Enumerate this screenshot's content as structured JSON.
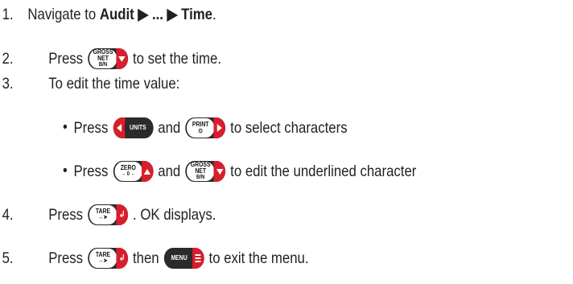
{
  "steps": [
    {
      "num": "1.",
      "pre": "Navigate to ",
      "bold": "Audit ▶ ... ▶  Time",
      "post": "."
    },
    {
      "num": "2.",
      "pre": "Press",
      "post": "to set the time."
    },
    {
      "num": "3.",
      "text": "To edit the time value:"
    },
    {
      "num": "4.",
      "pre": "Press",
      "post": ". OK displays."
    },
    {
      "num": "5.",
      "pre": "Press",
      "mid": "then",
      "post": "to exit the menu."
    }
  ],
  "substeps": [
    {
      "bullet": "•",
      "pre": "Press",
      "mid": "and",
      "post": "to select characters"
    },
    {
      "bullet": "•",
      "pre": "Press",
      "mid": "and",
      "post": "to edit the underlined character"
    }
  ],
  "keys": {
    "gross_net": {
      "l1": "GROSS",
      "l2": "NET",
      "l3": "B/N",
      "icon": "triangle-down-icon"
    },
    "units": {
      "l1": "UNITS",
      "icon": "triangle-left-icon"
    },
    "print": {
      "l1": "PRINT",
      "l2": "⊙",
      "icon": "triangle-right-icon"
    },
    "zero": {
      "l1": "ZERO",
      "l2": "→ 0 ←",
      "icon": "triangle-up-icon"
    },
    "tare": {
      "l1": "TARE",
      "l2": "↔➤",
      "icon": "enter-icon"
    },
    "menu": {
      "l1": "MENU",
      "icon": "menu-icon"
    }
  },
  "colors": {
    "key_body": "#2b2b2b",
    "key_accent": "#d81e2c",
    "text": "#231f20"
  }
}
